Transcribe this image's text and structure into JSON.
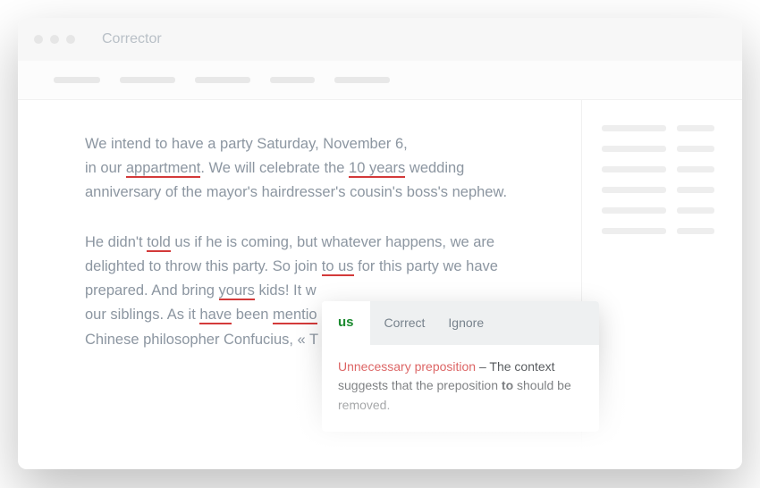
{
  "app": {
    "title": "Corrector"
  },
  "editor": {
    "p1": {
      "t1": "We intend to have a party Saturday, November 6,",
      "t2": "in our ",
      "e1": "appartment",
      "t3": ".  We will celebrate the ",
      "e2": "10 years",
      "t4": " wedding",
      "t5": "anniversary of the mayor's hairdresser's cousin's boss's nephew."
    },
    "p2": {
      "t1": "He didn't ",
      "e1": "told",
      "t2": " us if he is coming, but whatever happens, we are",
      "t3": "delighted to throw this party. So join ",
      "e2": "to us",
      "t4": " for this party we have",
      "t5": "prepared. And bring ",
      "e3": "yours",
      "t6": " kids! It w",
      "t7": "our siblings. As it ",
      "e4": "have",
      "t8": " been ",
      "e5": "mentio",
      "t9": "Chinese philosopher Confucius, « T"
    }
  },
  "tooltip": {
    "suggestion": "us",
    "actions": {
      "correct": "Correct",
      "ignore": "Ignore"
    },
    "title": "Unnecessary preposition",
    "sep": " – ",
    "body_a": "The context suggests that the preposition ",
    "body_bold": "to",
    "body_b": " should be removed."
  }
}
